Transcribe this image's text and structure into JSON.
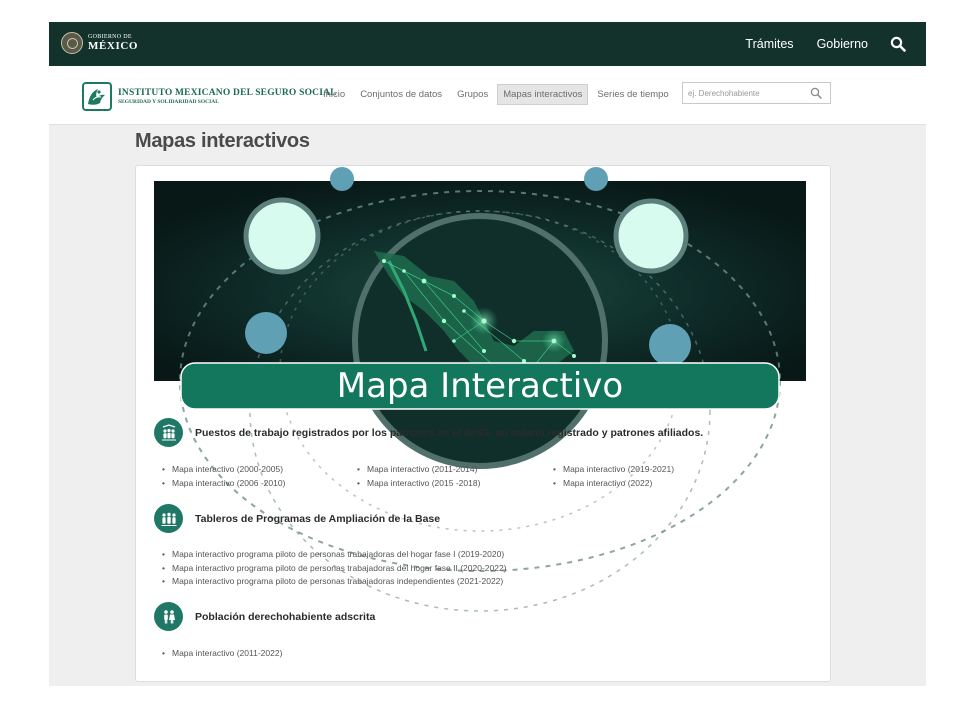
{
  "gob_header": {
    "logo_line1": "GOBIERNO DE",
    "logo_line2": "MÉXICO",
    "links": [
      "Trámites",
      "Gobierno"
    ]
  },
  "imss_header": {
    "logo_line1": "INSTITUTO MEXICANO DEL SEGURO SOCIAL",
    "logo_line2": "SEGURIDAD Y SOLIDARIDAD SOCIAL",
    "nav": [
      {
        "label": "Inicio",
        "active": false
      },
      {
        "label": "Conjuntos de datos",
        "active": false
      },
      {
        "label": "Grupos",
        "active": false
      },
      {
        "label": "Mapas interactivos",
        "active": true
      },
      {
        "label": "Series de tiempo",
        "active": false
      }
    ],
    "search_placeholder": "ej. Derechohabiente"
  },
  "page": {
    "title": "Mapas interactivos",
    "banner_text": "Mapa Interactivo"
  },
  "sections": [
    {
      "icon": "workers-group-icon",
      "title": "Puestos de trabajo registrados por los patrones en el IMSS, su salario registrado y patrones afiliados.",
      "columns": [
        [
          "Mapa interactivo (2000-2005)",
          "Mapa interactivo (2006 -2010)"
        ],
        [
          "Mapa interactivo (2011-2014)",
          "Mapa interactivo (2015 -2018)"
        ],
        [
          "Mapa interactivo (2019-2021)",
          "Mapa interactivo (2022)"
        ]
      ]
    },
    {
      "icon": "people-group-icon",
      "title": "Tableros de Programas de Ampliación de la Base",
      "items": [
        "Mapa interactivo programa piloto de personas trabajadoras del hogar fase I (2019-2020)",
        "Mapa interactivo programa piloto de personas trabajadoras del hogar fase II (2020-2022)",
        "Mapa interactivo programa piloto de personas trabajadoras independientes (2021-2022)"
      ]
    },
    {
      "icon": "family-icon",
      "title": "Población derechohabiente adscrita",
      "items": [
        "Mapa interactivo (2011-2022)"
      ]
    }
  ],
  "colors": {
    "gob_bar": "#13322b",
    "imss_green": "#1f7866",
    "banner_bg": "#0b1f1e",
    "banner_pill": "#12775c"
  }
}
